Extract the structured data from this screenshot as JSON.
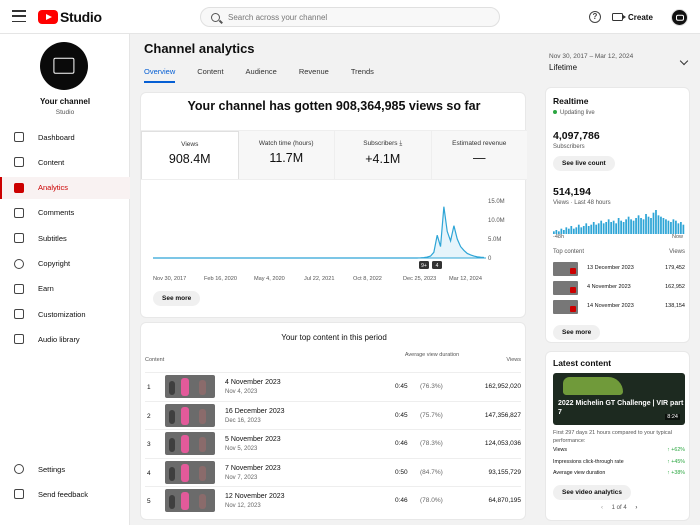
{
  "app": {
    "logo_text": "Studio",
    "search_placeholder": "Search across your channel",
    "create_label": "Create"
  },
  "channel": {
    "name": "Your channel",
    "subtitle": "Studio"
  },
  "sidebar": {
    "items": [
      {
        "label": "Dashboard",
        "icon": "dashboard-icon"
      },
      {
        "label": "Content",
        "icon": "content-icon"
      },
      {
        "label": "Analytics",
        "icon": "analytics-icon",
        "active": true
      },
      {
        "label": "Comments",
        "icon": "comments-icon"
      },
      {
        "label": "Subtitles",
        "icon": "subtitles-icon"
      },
      {
        "label": "Copyright",
        "icon": "copyright-icon"
      },
      {
        "label": "Earn",
        "icon": "earn-icon"
      },
      {
        "label": "Customization",
        "icon": "customization-icon"
      },
      {
        "label": "Audio library",
        "icon": "audio-library-icon"
      }
    ],
    "bottom": [
      {
        "label": "Settings",
        "icon": "gear-icon"
      },
      {
        "label": "Send feedback",
        "icon": "feedback-icon"
      }
    ]
  },
  "page": {
    "title": "Channel analytics",
    "tabs": [
      "Overview",
      "Content",
      "Audience",
      "Revenue",
      "Trends"
    ],
    "date_range": "Nov 30, 2017 – Mar 12, 2024",
    "date_label": "Lifetime"
  },
  "overview": {
    "headline": "Your channel has gotten 908,364,985 views so far",
    "metrics": [
      {
        "label": "Views",
        "value": "908.4M"
      },
      {
        "label": "Watch time (hours)",
        "value": "11.7M"
      },
      {
        "label": "Subscribers",
        "value": "+4.1M"
      },
      {
        "label": "Estimated revenue",
        "value": "—"
      }
    ],
    "see_more": "See more"
  },
  "chart_data": {
    "type": "line",
    "x_tick_labels": [
      "Nov 30, 2017",
      "Feb 16, 2020",
      "May 4, 2020",
      "Jul 22, 2021",
      "Oct 8, 2022",
      "Dec 25, 2023",
      "Mar 12, 2024"
    ],
    "y_tick_labels": [
      "15.0M",
      "10.0M",
      "5.0M",
      "0"
    ],
    "ylim": [
      0,
      15000000
    ],
    "series": [
      {
        "values": [
          0,
          0,
          0,
          0,
          0,
          0,
          0,
          0,
          0,
          0,
          0,
          0,
          0,
          0,
          0,
          0,
          0,
          0,
          0,
          0,
          0,
          0,
          0,
          0,
          0,
          0,
          0,
          0,
          0,
          0,
          0,
          0,
          0,
          0,
          0,
          0,
          0,
          0,
          0,
          0,
          0,
          0,
          0,
          0,
          0,
          0,
          0,
          0,
          0,
          0,
          0,
          0,
          0,
          0,
          0,
          0,
          0,
          0,
          0,
          0,
          0,
          0,
          0,
          0,
          0,
          0,
          0,
          0,
          0,
          0,
          0,
          0,
          0,
          0,
          0,
          0,
          0,
          0,
          0,
          0,
          50000,
          120000,
          250000,
          500000,
          1500000,
          6000000,
          3000000,
          13500000,
          7000000,
          4500000,
          8500000,
          5000000,
          3000000,
          2000000,
          1200000,
          800000,
          500000,
          300000,
          200000,
          150000
        ]
      }
    ],
    "markers": [
      "9+",
      "4"
    ],
    "grid": false
  },
  "top_content": {
    "title": "Your top content in this period",
    "headers": {
      "content": "Content",
      "avd": "Average view duration",
      "views": "Views"
    },
    "rows": [
      {
        "idx": "1",
        "title": "4 November 2023",
        "date": "Nov 4, 2023",
        "dur": "0:45",
        "pct": "(76.3%)",
        "views": "162,952,020"
      },
      {
        "idx": "2",
        "title": "16 December 2023",
        "date": "Dec 16, 2023",
        "dur": "0:45",
        "pct": "(75.7%)",
        "views": "147,356,827"
      },
      {
        "idx": "3",
        "title": "5 November 2023",
        "date": "Nov 5, 2023",
        "dur": "0:46",
        "pct": "(78.3%)",
        "views": "124,053,036"
      },
      {
        "idx": "4",
        "title": "7 November 2023",
        "date": "Nov 7, 2023",
        "dur": "0:50",
        "pct": "(84.7%)",
        "views": "93,155,729"
      },
      {
        "idx": "5",
        "title": "12 November 2023",
        "date": "Nov 12, 2023",
        "dur": "0:46",
        "pct": "(78.0%)",
        "views": "64,870,195"
      }
    ]
  },
  "realtime": {
    "title": "Realtime",
    "live": "Updating live",
    "subs": "4,097,786",
    "subs_label": "Subscribers",
    "see_live": "See live count",
    "views": "514,194",
    "views_label": "Views · Last 48 hours",
    "axis_left": "-48h",
    "axis_right": "Now",
    "bars": [
      2,
      3,
      2,
      4,
      3,
      5,
      4,
      6,
      4,
      5,
      7,
      5,
      6,
      8,
      6,
      7,
      9,
      7,
      8,
      10,
      8,
      9,
      11,
      9,
      10,
      8,
      12,
      10,
      9,
      11,
      13,
      11,
      10,
      12,
      14,
      12,
      11,
      15,
      13,
      12,
      16,
      18,
      14,
      13,
      12,
      11,
      10,
      9,
      11,
      10,
      8,
      9,
      7
    ],
    "top_header": "Top content",
    "views_header": "Views",
    "top": [
      {
        "date": "13 December 2023",
        "views": "179,452"
      },
      {
        "date": "4 November 2023",
        "views": "162,952"
      },
      {
        "date": "14 November 2023",
        "views": "138,154"
      }
    ],
    "see_more": "See more"
  },
  "latest": {
    "title": "Latest content",
    "caption": "2022 Michelin GT Challenge | VIR part 7",
    "duration": "8:24",
    "first_line": "First 297 days 21 hours compared to your typical performance:",
    "perf": [
      {
        "label": "Views",
        "value": "↑ +62%"
      },
      {
        "label": "Impressions click-through rate",
        "value": "↑ +45%"
      },
      {
        "label": "Average view duration",
        "value": "↑ +38%"
      }
    ],
    "button": "See video analytics",
    "pager": "1 of 4"
  }
}
